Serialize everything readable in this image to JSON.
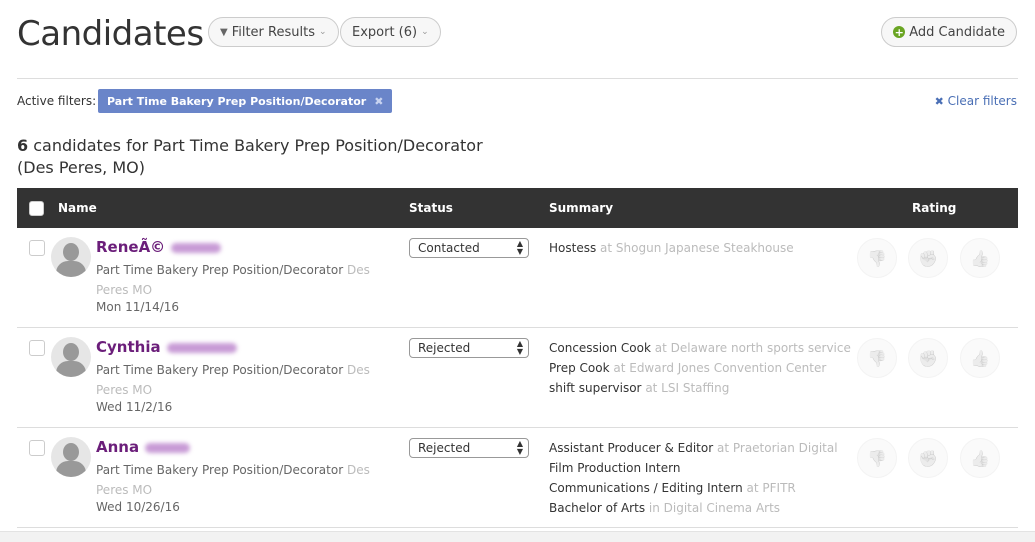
{
  "header": {
    "title": "Candidates",
    "filter_label": "Filter Results",
    "export_label": "Export (6)",
    "add_label": "Add Candidate",
    "add_icon_color": "#6aa523"
  },
  "filters": {
    "label": "Active filters:",
    "chip": "Part Time Bakery Prep Position/Decorator",
    "clear_label": "Clear filters"
  },
  "summary": {
    "count": "6",
    "text": " candidates for Part Time Bakery Prep Position/Decorator",
    "location": "(Des Peres, MO)"
  },
  "table": {
    "columns": [
      "Name",
      "Status",
      "Summary",
      "Rating"
    ],
    "rows": [
      {
        "name": "ReneÃ©",
        "job": "Part Time Bakery Prep Position/Decorator",
        "location": "Des Peres MO",
        "date": "Mon 11/14/16",
        "status": "Contacted",
        "summary": [
          {
            "title": "Hostess",
            "detail": "at Shogun Japanese Steakhouse"
          }
        ]
      },
      {
        "name": "Cynthia",
        "job": "Part Time Bakery Prep Position/Decorator",
        "location": "Des Peres MO",
        "date": "Wed 11/2/16",
        "status": "Rejected",
        "summary": [
          {
            "title": "Concession Cook",
            "detail": "at Delaware north sports service"
          },
          {
            "title": "Prep Cook",
            "detail": "at Edward Jones Convention Center"
          },
          {
            "title": "shift supervisor",
            "detail": "at LSI Staffing"
          }
        ]
      },
      {
        "name": "Anna",
        "job": "Part Time Bakery Prep Position/Decorator",
        "location": "Des Peres MO",
        "date": "Wed 10/26/16",
        "status": "Rejected",
        "summary": [
          {
            "title": "Assistant Producer & Editor",
            "detail": "at Praetorian Digital"
          },
          {
            "title": "Film Production Intern",
            "detail": ""
          },
          {
            "title": "Communications / Editing Intern",
            "detail": "at PFITR"
          },
          {
            "title": "Bachelor of Arts",
            "detail": "in Digital Cinema Arts"
          }
        ]
      }
    ]
  },
  "icons": {
    "rating": [
      "thumbs-down-icon",
      "neutral-fist-icon",
      "thumbs-up-icon"
    ]
  }
}
